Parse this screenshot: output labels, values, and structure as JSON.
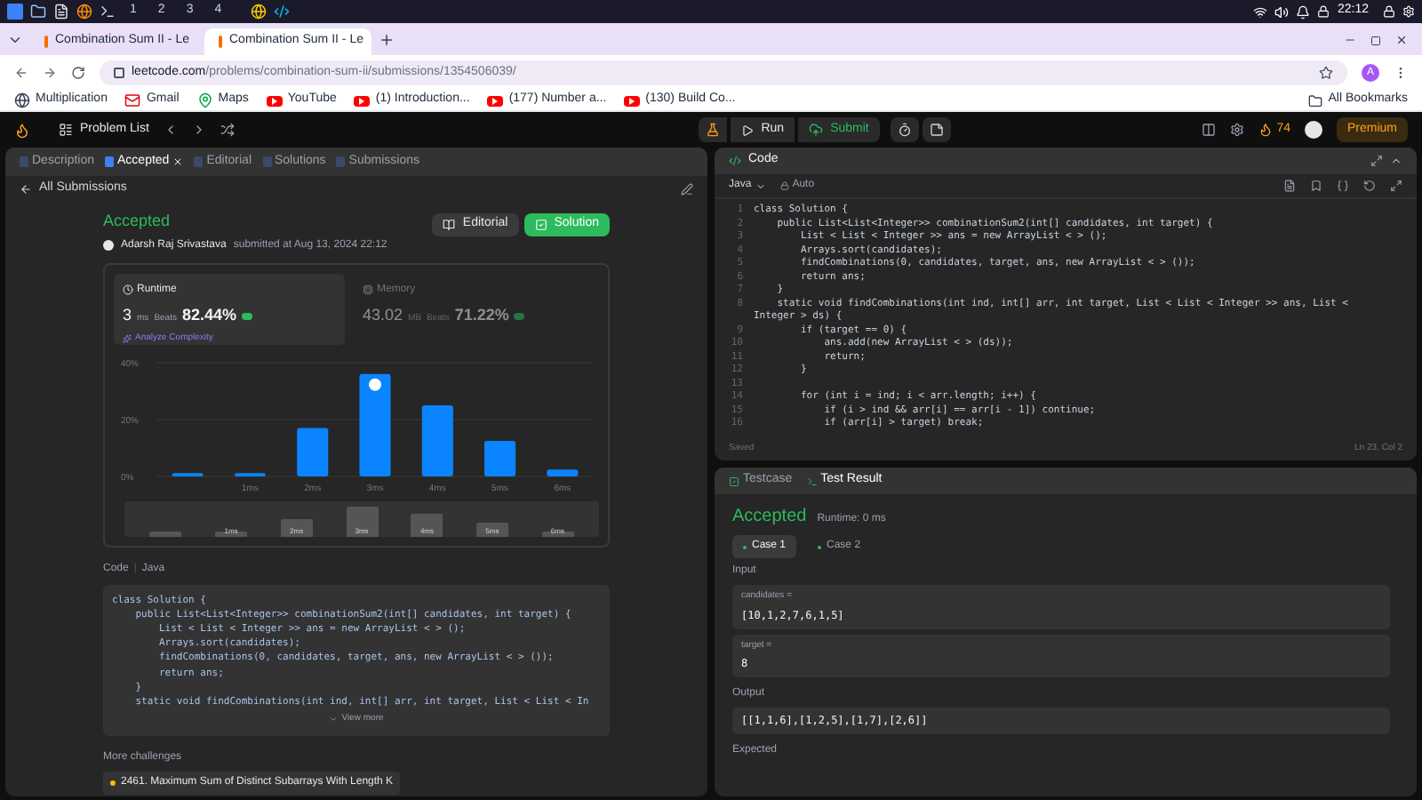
{
  "taskbar": {
    "workspaces": [
      "1",
      "2",
      "3",
      "4"
    ],
    "time": "22:12"
  },
  "browser": {
    "tabs": [
      {
        "title": "Combination Sum II - Le",
        "selected": false
      },
      {
        "title": "Combination Sum II - Le",
        "selected": true
      }
    ],
    "url_host": "leetcode.com",
    "url_path": "/problems/combination-sum-ii/submissions/1354506039/",
    "profile": "A",
    "bookmarks": [
      {
        "label": "Multiplication",
        "kind": "globe"
      },
      {
        "label": "Gmail",
        "kind": "mail"
      },
      {
        "label": "Maps",
        "kind": "map"
      },
      {
        "label": "YouTube",
        "kind": "video"
      },
      {
        "label": "(1) Introduction...",
        "kind": "video"
      },
      {
        "label": "(177) Number a...",
        "kind": "video"
      },
      {
        "label": "(130) Build Co...",
        "kind": "video"
      }
    ],
    "all_bookmarks": "All Bookmarks"
  },
  "nav": {
    "problem_list": "Problem List",
    "run": "Run",
    "submit": "Submit",
    "streak": "74",
    "premium": "Premium"
  },
  "left_tabs": [
    {
      "label": "Description",
      "selected": false
    },
    {
      "label": "Accepted",
      "selected": true
    },
    {
      "label": "Editorial",
      "selected": false
    },
    {
      "label": "Solutions",
      "selected": false
    },
    {
      "label": "Submissions",
      "selected": false
    }
  ],
  "back_link": "All Submissions",
  "submission": {
    "status": "Accepted",
    "author": "Adarsh Raj Srivastava",
    "submitted": "submitted at Aug 13, 2024 22:12",
    "editorial_button": "Editorial",
    "solution_button": "Solution",
    "stats": [
      {
        "title": "Runtime",
        "value": "3",
        "unit": "ms",
        "beats_label": "Beats",
        "beats": "82.44%",
        "selected": true
      },
      {
        "title": "Memory",
        "value": "43.02",
        "unit": "MB",
        "beats_label": "Beats",
        "beats": "71.22%",
        "selected": false
      }
    ],
    "analyze": "Analyze Complexity",
    "chart_data": {
      "type": "bar",
      "categories": [
        null,
        "1ms",
        "2ms",
        "3ms",
        "4ms",
        "5ms",
        "6ms"
      ],
      "values": [
        1.2,
        1.2,
        17,
        36,
        25,
        12.5,
        2.4
      ],
      "ylim": [
        0,
        40
      ],
      "yticks": [
        {
          "value": 0,
          "label": "0%"
        },
        {
          "value": 20,
          "label": "20%"
        },
        {
          "value": 40,
          "label": "40%"
        }
      ]
    },
    "range_labels": [
      "1ms",
      "2ms",
      "3ms",
      "4ms",
      "5ms",
      "6ms"
    ],
    "code_label": "Code",
    "code_separator": "|",
    "code_lang": "Java",
    "code": [
      "class Solution {",
      "    public List<List<Integer>> combinationSum2(int[] candidates, int target) {",
      "        List < List < Integer >> ans = new ArrayList < > ();",
      "        Arrays.sort(candidates);",
      "        findCombinations(0, candidates, target, ans, new ArrayList < > ());",
      "        return ans;",
      "    }",
      "    static void findCombinations(int ind, int[] arr, int target, List < List < In"
    ],
    "view_more": "View more",
    "more_challenges": "More challenges",
    "challenge": "2461. Maximum Sum of Distinct Subarrays With Length K"
  },
  "editor": {
    "title": "Code",
    "language": "Java",
    "mode": "Auto",
    "lines": [
      {
        "n": "1",
        "text": "class Solution {"
      },
      {
        "n": "2",
        "text": "    public List<List<Integer>> combinationSum2(int[] candidates, int target) {"
      },
      {
        "n": "3",
        "text": "        List < List < Integer >> ans = new ArrayList < > ();"
      },
      {
        "n": "4",
        "text": "        Arrays.sort(candidates);"
      },
      {
        "n": "5",
        "text": "        findCombinations(0, candidates, target, ans, new ArrayList < > ());"
      },
      {
        "n": "6",
        "text": "        return ans;"
      },
      {
        "n": "7",
        "text": "    }"
      },
      {
        "n": "8",
        "text": "    static void findCombinations(int ind, int[] arr, int target, List < List < Integer >> ans, List < Integer > ds) {"
      },
      {
        "n": "9",
        "text": "        if (target == 0) {"
      },
      {
        "n": "10",
        "text": "            ans.add(new ArrayList < > (ds));"
      },
      {
        "n": "11",
        "text": "            return;"
      },
      {
        "n": "12",
        "text": "        }"
      },
      {
        "n": "13"
      },
      {
        "n": "14",
        "text": "        for (int i = ind; i < arr.length; i++) {"
      },
      {
        "n": "15",
        "text": "            if (i > ind && arr[i] == arr[i - 1]) continue;"
      },
      {
        "n": "16",
        "text": "            if (arr[i] > target) break;"
      }
    ],
    "saved": "Saved",
    "cursor": "Ln 23, Col 2"
  },
  "result": {
    "tabs": [
      {
        "label": "Testcase",
        "selected": false
      },
      {
        "label": "Test Result",
        "selected": true
      }
    ],
    "status": "Accepted",
    "runtime": "Runtime: 0 ms",
    "cases": [
      {
        "label": "Case 1",
        "selected": true
      },
      {
        "label": "Case 2",
        "selected": false
      }
    ],
    "input_label": "Input",
    "inputs": [
      {
        "name": "candidates =",
        "value": "[10,1,2,7,6,1,5]"
      },
      {
        "name": "target =",
        "value": "8"
      }
    ],
    "output_label": "Output",
    "output": "[[1,1,6],[1,2,5],[1,7],[2,6]]",
    "expected_label": "Expected"
  }
}
